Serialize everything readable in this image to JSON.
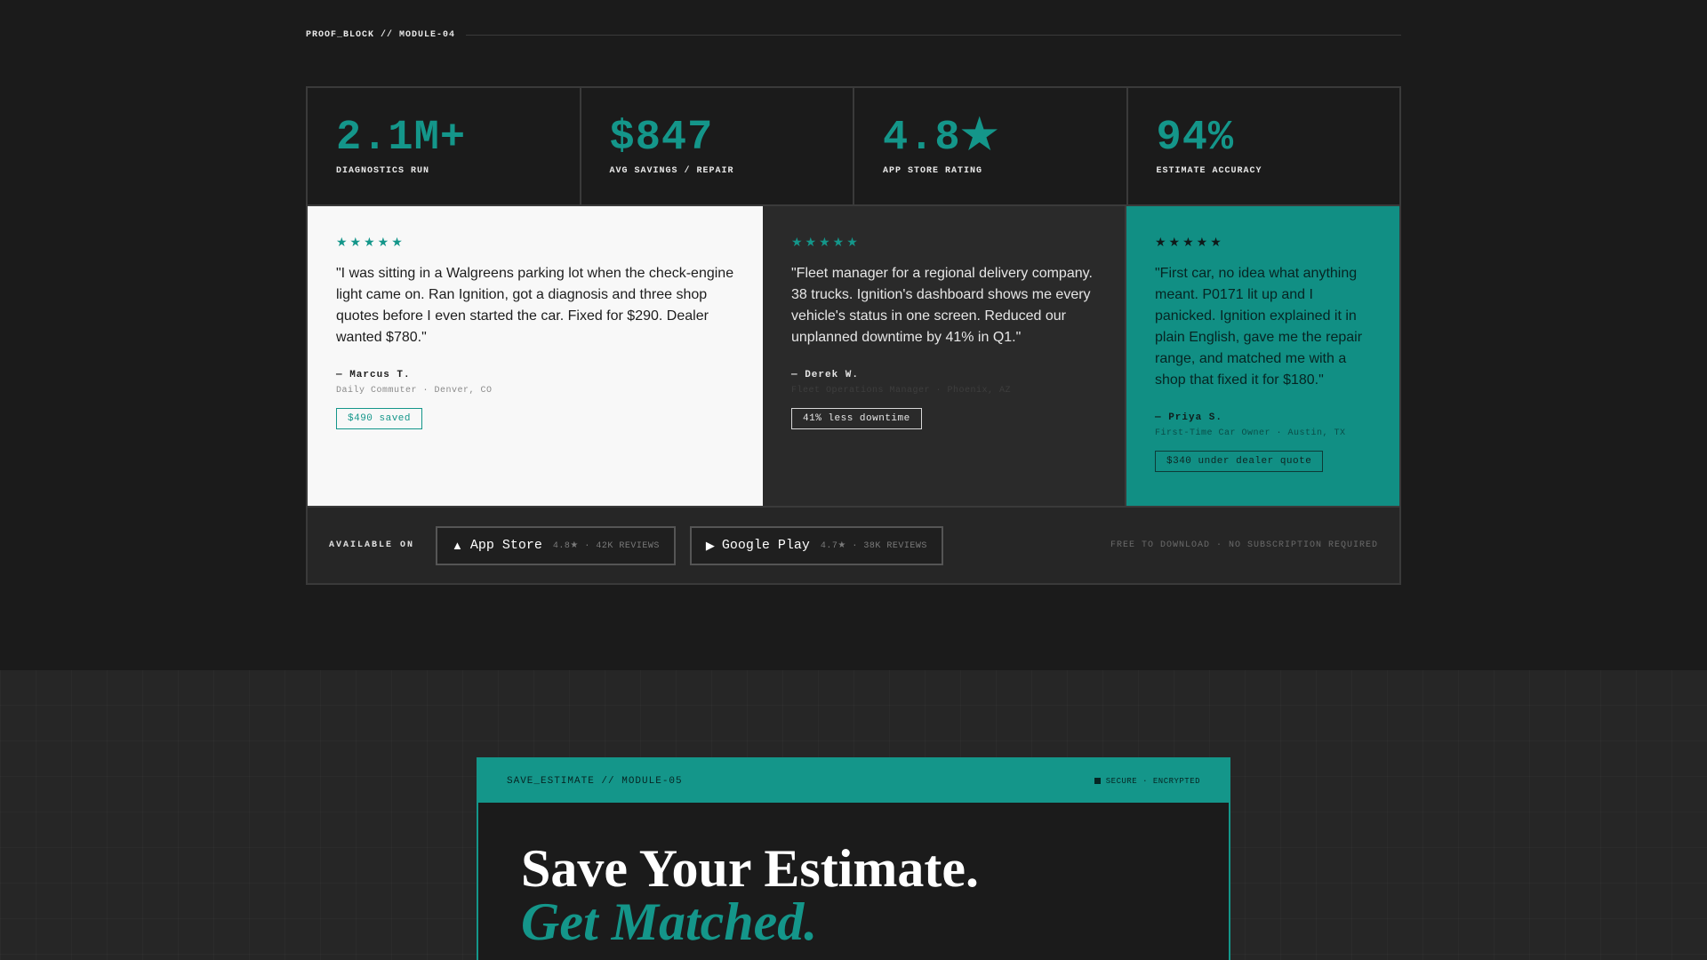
{
  "proof": {
    "header": "PROOF_BLOCK // MODULE-04",
    "stats": [
      {
        "value": "2.1M+",
        "label": "DIAGNOSTICS RUN"
      },
      {
        "value": "$847",
        "label": "AVG SAVINGS / REPAIR"
      },
      {
        "value": "4.8★",
        "label": "APP STORE RATING"
      },
      {
        "value": "94%",
        "label": "ESTIMATE ACCURACY"
      }
    ],
    "testimonials": [
      {
        "stars": "★★★★★",
        "quote": "\"I was sitting in a Walgreens parking lot when the check-engine light came on. Ran Ignition, got a diagnosis and three shop quotes before I even started the car. Fixed for $290. Dealer wanted $780.\"",
        "author": "— Marcus T.",
        "meta": "Daily Commuter · Denver, CO",
        "badge": "$490 saved"
      },
      {
        "stars": "★★★★★",
        "quote": "\"Fleet manager for a regional delivery company. 38 trucks. Ignition's dashboard shows me every vehicle's status in one screen. Reduced our unplanned downtime by 41% in Q1.\"",
        "author": "— Derek W.",
        "meta": "Fleet Operations Manager · Phoenix, AZ",
        "badge": "41% less downtime"
      },
      {
        "stars": "★★★★★",
        "quote": "\"First car, no idea what anything meant. P0171 lit up and I panicked. Ignition explained it in plain English, gave me the repair range, and matched me with a shop that fixed it for $180.\"",
        "author": "— Priya S.",
        "meta": "First-Time Car Owner · Austin, TX",
        "badge": "$340 under dealer quote"
      }
    ],
    "available": {
      "label": "AVAILABLE ON",
      "app_store": {
        "icon": "▲",
        "name": "App Store",
        "meta": "4.8★ · 42K REVIEWS"
      },
      "google_play": {
        "icon": "▶",
        "name": "Google Play",
        "meta": "4.7★ · 38K REVIEWS"
      },
      "note": "FREE TO DOWNLOAD · NO SUBSCRIPTION REQUIRED"
    }
  },
  "estimate": {
    "module_label": "SAVE_ESTIMATE // MODULE-05",
    "secure_label": "SECURE · ENCRYPTED",
    "headline_line1": "Save Your Estimate.",
    "headline_line2": "Get Matched."
  },
  "colors": {
    "accent": "#14968a",
    "background": "#1b1b1b"
  }
}
